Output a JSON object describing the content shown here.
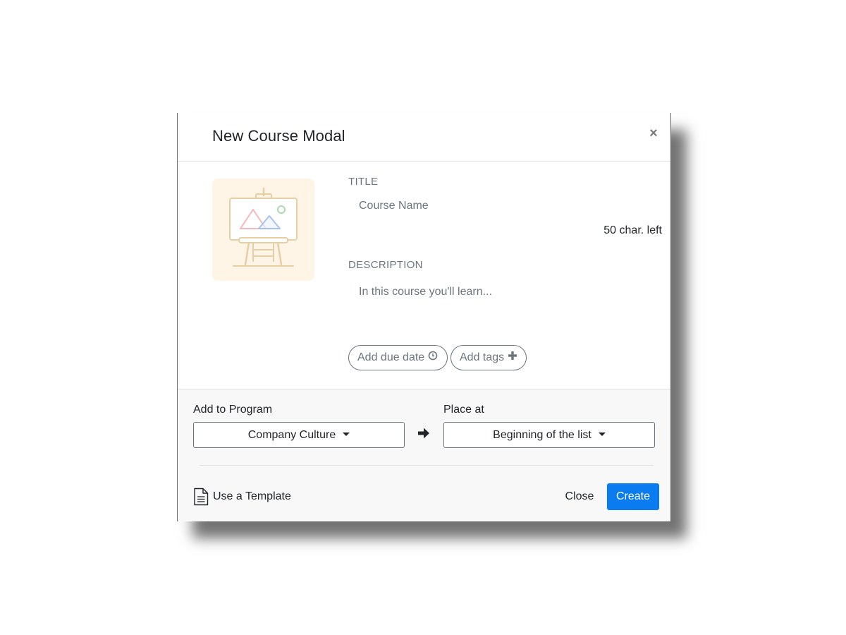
{
  "modal": {
    "title": "New Course Modal",
    "close_icon": "×"
  },
  "course": {
    "image_icon": "easel-icon",
    "title_label": "TITLE",
    "title_placeholder": "Course Name",
    "title_value": "",
    "char_left": "50 char. left",
    "description_label": "DESCRIPTION",
    "description_placeholder": "In this course you'll learn...",
    "description_value": ""
  },
  "pills": {
    "due_date_label": "Add due date",
    "due_date_icon": "clock-icon",
    "tags_label": "Add tags",
    "tags_icon": "plus-icon"
  },
  "program": {
    "label": "Add to Program",
    "selected": "Company Culture"
  },
  "arrow_icon": "arrow-right-icon",
  "place": {
    "label": "Place at",
    "selected": "Beginning of the list"
  },
  "footer": {
    "template_label": "Use a Template",
    "template_icon": "document-icon",
    "close_label": "Close",
    "create_label": "Create"
  },
  "colors": {
    "primary": "#0a7cf0",
    "thumbnail_bg": "#fff5e6",
    "footer_bg": "#f8f8f8",
    "muted_text": "#6c757d"
  }
}
